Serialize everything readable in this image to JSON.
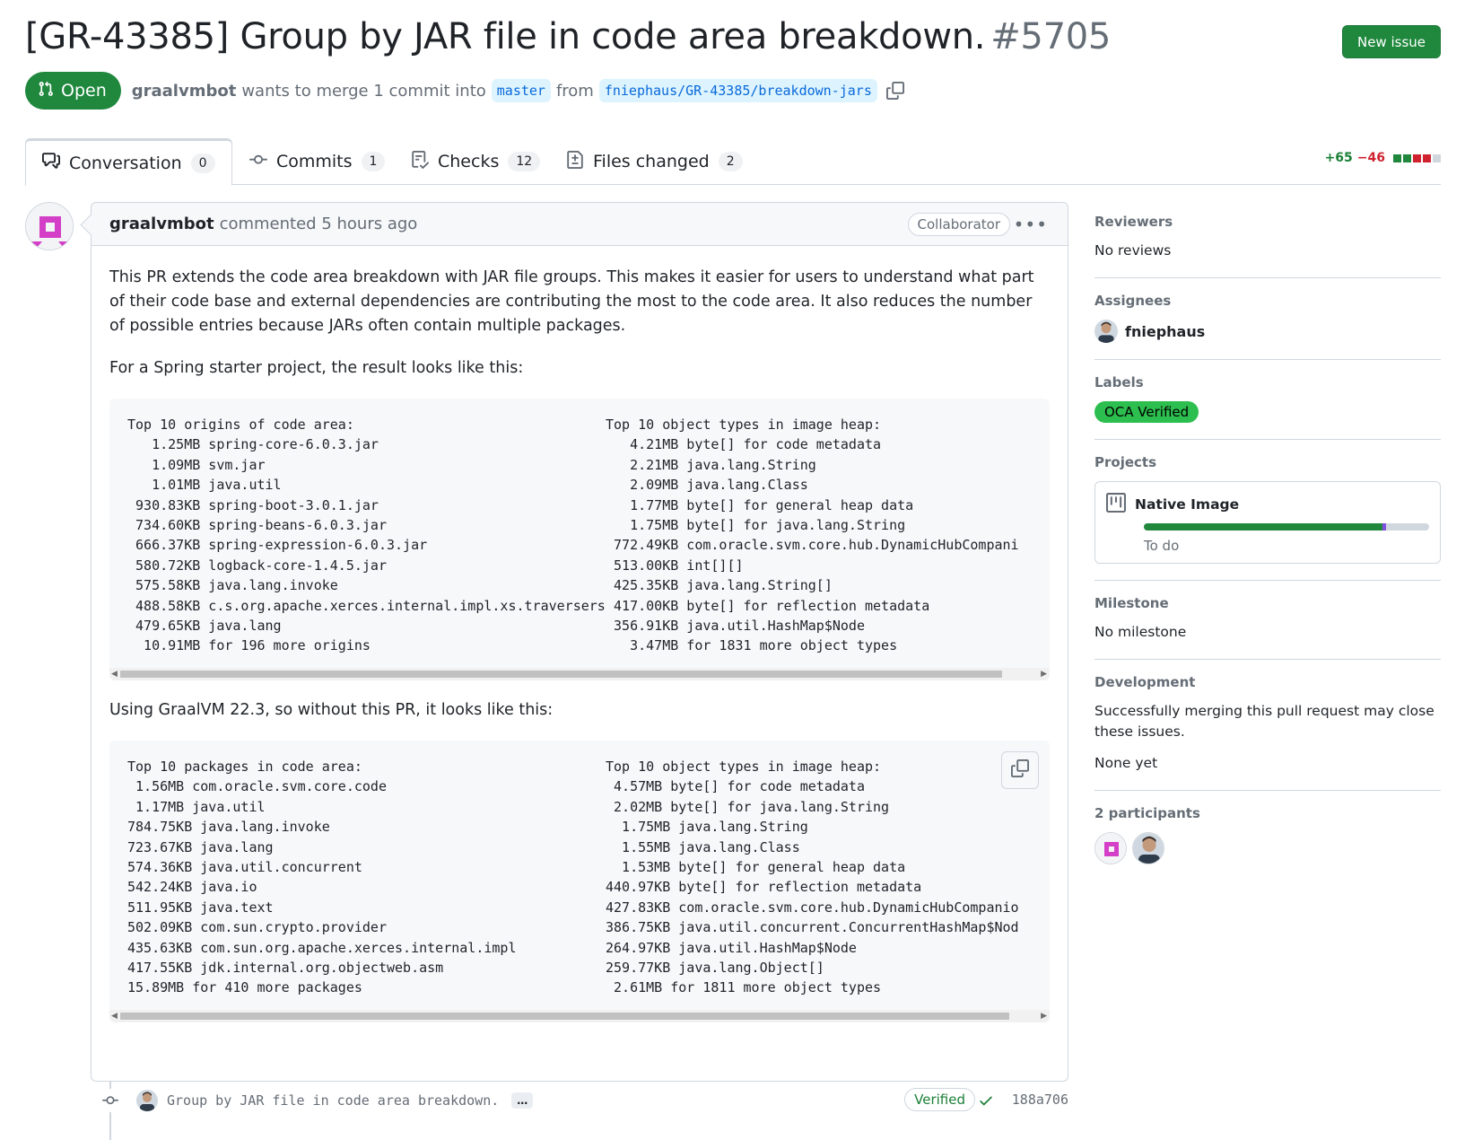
{
  "header": {
    "title": "[GR-43385] Group by JAR file in code area breakdown.",
    "number": "#5705",
    "new_issue_label": "New issue",
    "state": "Open",
    "author": "graalvmbot",
    "merge_text_1": "wants to merge 1 commit into",
    "base_branch": "master",
    "merge_text_2": "from",
    "head_branch": "fniephaus/GR-43385/breakdown-jars"
  },
  "tabs": [
    {
      "label": "Conversation",
      "count": "0"
    },
    {
      "label": "Commits",
      "count": "1"
    },
    {
      "label": "Checks",
      "count": "12"
    },
    {
      "label": "Files changed",
      "count": "2"
    }
  ],
  "diffstat": {
    "additions": "+65",
    "deletions": "−46"
  },
  "comment": {
    "author": "graalvmbot",
    "action": "commented 5 hours ago",
    "role_badge": "Collaborator",
    "paragraph_1": "This PR extends the code area breakdown with JAR file groups. This makes it easier for users to understand what part of their code base and external dependencies are contributing the most to the code area. It also reduces the number of possible entries because JARs often contain multiple packages.",
    "paragraph_2": "For a Spring starter project, the result looks like this:",
    "code_1_left": "Top 10 origins of code area:\n   1.25MB spring-core-6.0.3.jar\n   1.09MB svm.jar\n   1.01MB java.util\n 930.83KB spring-boot-3.0.1.jar\n 734.60KB spring-beans-6.0.3.jar\n 666.37KB spring-expression-6.0.3.jar\n 580.72KB logback-core-1.4.5.jar\n 575.58KB java.lang.invoke\n 488.58KB c.s.org.apache.xerces.internal.impl.xs.traversers\n 479.65KB java.lang\n  10.91MB for 196 more origins",
    "code_1_right": "Top 10 object types in image heap:\n   4.21MB byte[] for code metadata\n   2.21MB java.lang.String\n   2.09MB java.lang.Class\n   1.77MB byte[] for general heap data\n   1.75MB byte[] for java.lang.String\n 772.49KB com.oracle.svm.core.hub.DynamicHubCompani\n 513.00KB int[][]\n 425.35KB java.lang.String[]\n 417.00KB byte[] for reflection metadata\n 356.91KB java.util.HashMap$Node\n   3.47MB for 1831 more object types",
    "paragraph_3": "Using GraalVM 22.3, so without this PR, it looks like this:",
    "code_2_left": "Top 10 packages in code area:\n 1.56MB com.oracle.svm.core.code\n 1.17MB java.util\n784.75KB java.lang.invoke\n723.67KB java.lang\n574.36KB java.util.concurrent\n542.24KB java.io\n511.95KB java.text\n502.09KB com.sun.crypto.provider\n435.63KB com.sun.org.apache.xerces.internal.impl\n417.55KB jdk.internal.org.objectweb.asm\n15.89MB for 410 more packages",
    "code_2_right": "Top 10 object types in image heap:\n 4.57MB byte[] for code metadata\n 2.02MB byte[] for java.lang.String\n  1.75MB java.lang.String\n  1.55MB java.lang.Class\n  1.53MB byte[] for general heap data\n440.97KB byte[] for reflection metadata\n427.83KB com.oracle.svm.core.hub.DynamicHubCompanio\n386.75KB java.util.concurrent.ConcurrentHashMap$Nod\n264.97KB java.util.HashMap$Node\n259.77KB java.lang.Object[]\n 2.61MB for 1811 more object types"
  },
  "commit": {
    "message": "Group by JAR file in code area breakdown.",
    "ellipsis": "…",
    "verified": "Verified",
    "sha": "188a706"
  },
  "sidebar": {
    "reviewers": {
      "heading": "Reviewers",
      "value": "No reviews"
    },
    "assignees": {
      "heading": "Assignees",
      "value": "fniephaus"
    },
    "labels": {
      "heading": "Labels",
      "value": "OCA Verified",
      "color": "#2cbe4e"
    },
    "projects": {
      "heading": "Projects",
      "name": "Native Image",
      "status": "To do",
      "progress_done": 0.835,
      "progress_in_progress": 0.015
    },
    "milestone": {
      "heading": "Milestone",
      "value": "No milestone"
    },
    "development": {
      "heading": "Development",
      "text": "Successfully merging this pull request may close these issues.",
      "value": "None yet"
    },
    "participants": {
      "heading": "2 participants"
    }
  },
  "colors": {
    "accent_green": "#1f883d",
    "link_blue": "#0969da",
    "additions": "#1a7f37",
    "deletions": "#cf222e"
  },
  "icons": [
    "git-pull-request-icon",
    "copy-icon",
    "comment-discussion-icon",
    "git-commit-icon",
    "checklist-icon",
    "file-diff-icon",
    "kebab-horizontal-icon",
    "check-icon",
    "project-icon"
  ]
}
